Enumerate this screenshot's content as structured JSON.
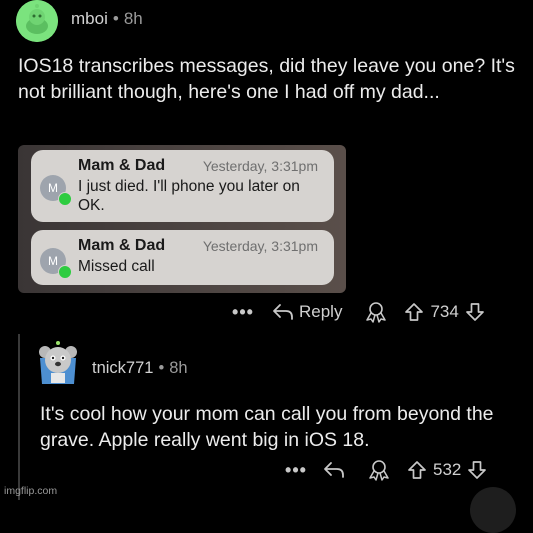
{
  "post": {
    "username": "mboi",
    "separator": "•",
    "time": "8h",
    "text": "IOS18 transcribes messages, did they leave you one? It's not brilliant though, here's one I had off my dad...",
    "actions": {
      "more": "•••",
      "reply_label": "Reply",
      "score": "734"
    }
  },
  "embed": {
    "notifications": [
      {
        "avatar_letter": "M",
        "sender": "Mam & Dad",
        "timestamp": "Yesterday, 3:31pm",
        "message": "I just died. I'll phone you later on OK."
      },
      {
        "avatar_letter": "M",
        "sender": "Mam & Dad",
        "timestamp": "Yesterday, 3:31pm",
        "message": "Missed call"
      }
    ]
  },
  "comment": {
    "username": "tnick771",
    "separator": "•",
    "time": "8h",
    "text": "It's cool how your mom can call you from beyond the grave. Apple really went big in iOS 18.",
    "actions": {
      "more": "•••",
      "score": "532"
    }
  },
  "watermark": "imgflip.com",
  "colors": {
    "background": "#000000",
    "avatar_green": "#7be37e",
    "notification_bg": "#d6d3d0"
  }
}
